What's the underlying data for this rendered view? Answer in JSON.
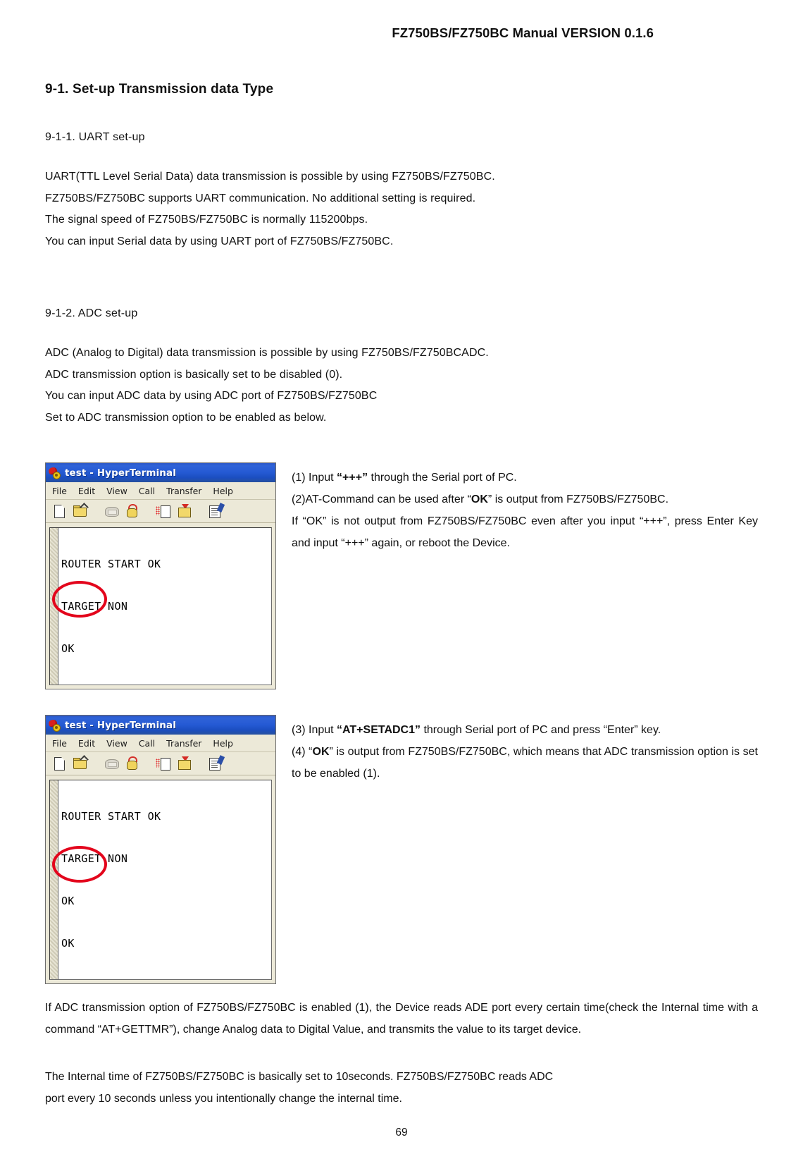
{
  "header": {
    "title": "FZ750BS/FZ750BC Manual VERSION 0.1.6"
  },
  "headings": {
    "section": "9-1. Set-up Transmission data Type",
    "sub_uart": "9-1-1. UART set-up",
    "sub_adc": "9-1-2. ADC set-up"
  },
  "uart_paragraph": {
    "line1": "UART(TTL Level Serial Data) data transmission is possible by using FZ750BS/FZ750BC.",
    "line2": "FZ750BS/FZ750BC supports UART communication. No additional setting is required.",
    "line3": "The signal speed of FZ750BS/FZ750BC is normally 115200bps.",
    "line4": "You can input Serial data by using UART port of FZ750BS/FZ750BC."
  },
  "adc_paragraph": {
    "line1": "ADC (Analog to Digital) data transmission is possible by using FZ750BS/FZ750BCADC.",
    "line2": "ADC transmission option is basically set to be disabled (0).",
    "line3": "You can input ADC data by using ADC port of FZ750BS/FZ750BC",
    "line4": "Set to ADC transmission option to be enabled as below."
  },
  "terminal1": {
    "title": "test - HyperTerminal",
    "menus": [
      "File",
      "Edit",
      "View",
      "Call",
      "Transfer",
      "Help"
    ],
    "toolbar_icons": [
      "new-icon",
      "open-icon",
      "disconnect-icon",
      "call-icon",
      "send-file-icon",
      "receive-file-icon",
      "properties-icon"
    ],
    "lines": [
      "ROUTER START OK",
      "TARGET NON",
      "OK"
    ],
    "annotation": "red-ellipse-around-ok"
  },
  "terminal2": {
    "title": "test - HyperTerminal",
    "menus": [
      "File",
      "Edit",
      "View",
      "Call",
      "Transfer",
      "Help"
    ],
    "toolbar_icons": [
      "new-icon",
      "open-icon",
      "disconnect-icon",
      "call-icon",
      "send-file-icon",
      "receive-file-icon",
      "properties-icon"
    ],
    "lines": [
      "ROUTER START OK",
      "TARGET NON",
      "OK",
      "OK"
    ],
    "annotation": "red-ellipse-around-ok"
  },
  "steps_block1": {
    "step1_pre": "(1) Input ",
    "step1_bold": "“+++”",
    "step1_post": " through the Serial port of PC.",
    "step2_pre": "(2)AT-Command can be used after “",
    "step2_bold": "OK",
    "step2_post": "” is output from FZ750BS/FZ750BC.",
    "step2_note": "If “OK” is not output from FZ750BS/FZ750BC even after you input “+++”, press Enter Key and input “+++” again, or reboot the Device."
  },
  "steps_block2": {
    "step3_pre": "(3) Input ",
    "step3_bold": "“AT+SETADC1”",
    "step3_post": " through Serial port of PC and press “Enter” key.",
    "step4_pre": "(4) “",
    "step4_bold": "OK",
    "step4_post": "” is output from FZ750BS/FZ750BC, which means that ADC transmission option is set to be enabled (1)."
  },
  "closing": {
    "paragraph1": "If ADC transmission option of FZ750BS/FZ750BC is enabled (1), the Device reads ADE port every certain time(check the Internal time with a command “AT+GETTMR”), change Analog data to Digital Value, and transmits the value to its target device.",
    "paragraph2_line1": "The Internal time of FZ750BS/FZ750BC is basically set to 10seconds. FZ750BS/FZ750BC reads ADC",
    "paragraph2_line2": " port every 10 seconds unless you intentionally change the internal time."
  },
  "footer": {
    "page_number": "69"
  },
  "colors": {
    "annotation_red": "#e3051c",
    "titlebar_blue": "#2558c9",
    "chrome_beige": "#ece9d8"
  }
}
